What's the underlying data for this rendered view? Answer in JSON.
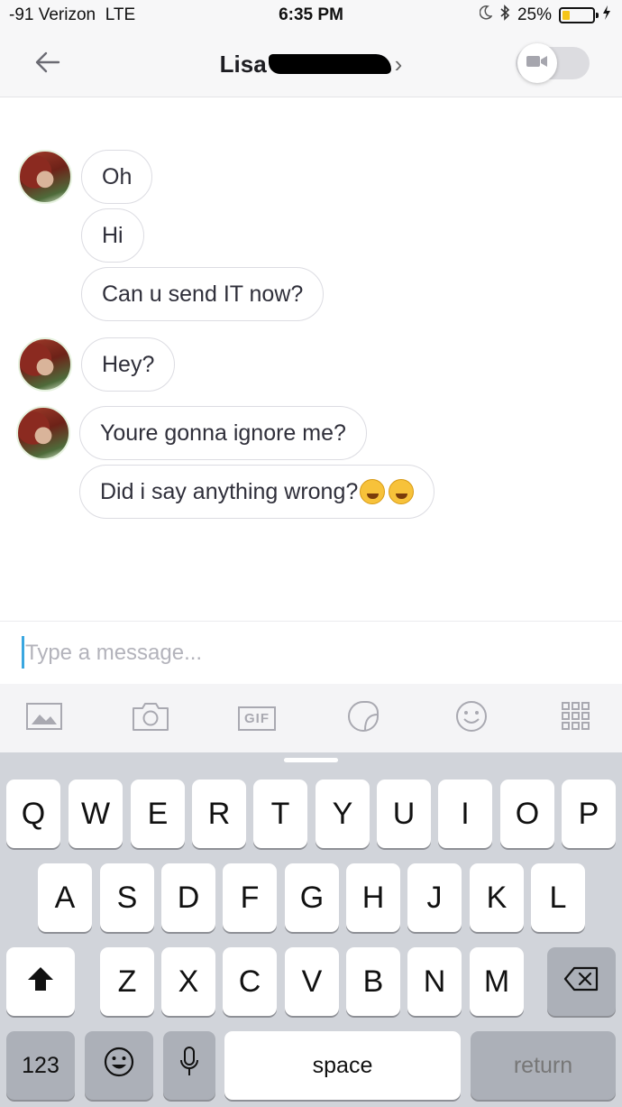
{
  "status_bar": {
    "carrier": "-91 Verizon",
    "network": "LTE",
    "time": "6:35 PM",
    "battery": "25%",
    "battery_level": 0.25,
    "battery_color": "#f5c518"
  },
  "header": {
    "contact_name": "Lisa",
    "back_icon": "arrow-left-icon",
    "chevron": "›",
    "video_icon": "video-camera-icon"
  },
  "messages": [
    {
      "text": "Oh"
    },
    {
      "text": "Hi"
    },
    {
      "text": "Can u send IT now?"
    },
    {
      "text": "Hey?"
    },
    {
      "text": "Youre gonna ignore me?"
    },
    {
      "text": "Did i say anything wrong?",
      "emojis": [
        "grinning-sweat-emoji",
        "upside-down-face-emoji"
      ]
    }
  ],
  "composer": {
    "placeholder": "Type a message...",
    "value": ""
  },
  "toolbar": {
    "gif_label": "GIF",
    "icons": [
      "image-icon",
      "camera-icon",
      "gif-icon",
      "sticker-icon",
      "smiley-icon",
      "grid-icon"
    ]
  },
  "keyboard": {
    "row1": [
      "Q",
      "W",
      "E",
      "R",
      "T",
      "Y",
      "U",
      "I",
      "O",
      "P"
    ],
    "row2": [
      "A",
      "S",
      "D",
      "F",
      "G",
      "H",
      "J",
      "K",
      "L"
    ],
    "row3": [
      "Z",
      "X",
      "C",
      "V",
      "B",
      "N",
      "M"
    ],
    "numbers_label": "123",
    "space_label": "space",
    "return_label": "return"
  },
  "colors": {
    "accent": "#3aa7e0",
    "bubble_border": "#dcdce2",
    "keyboard_bg": "#d1d4da"
  }
}
